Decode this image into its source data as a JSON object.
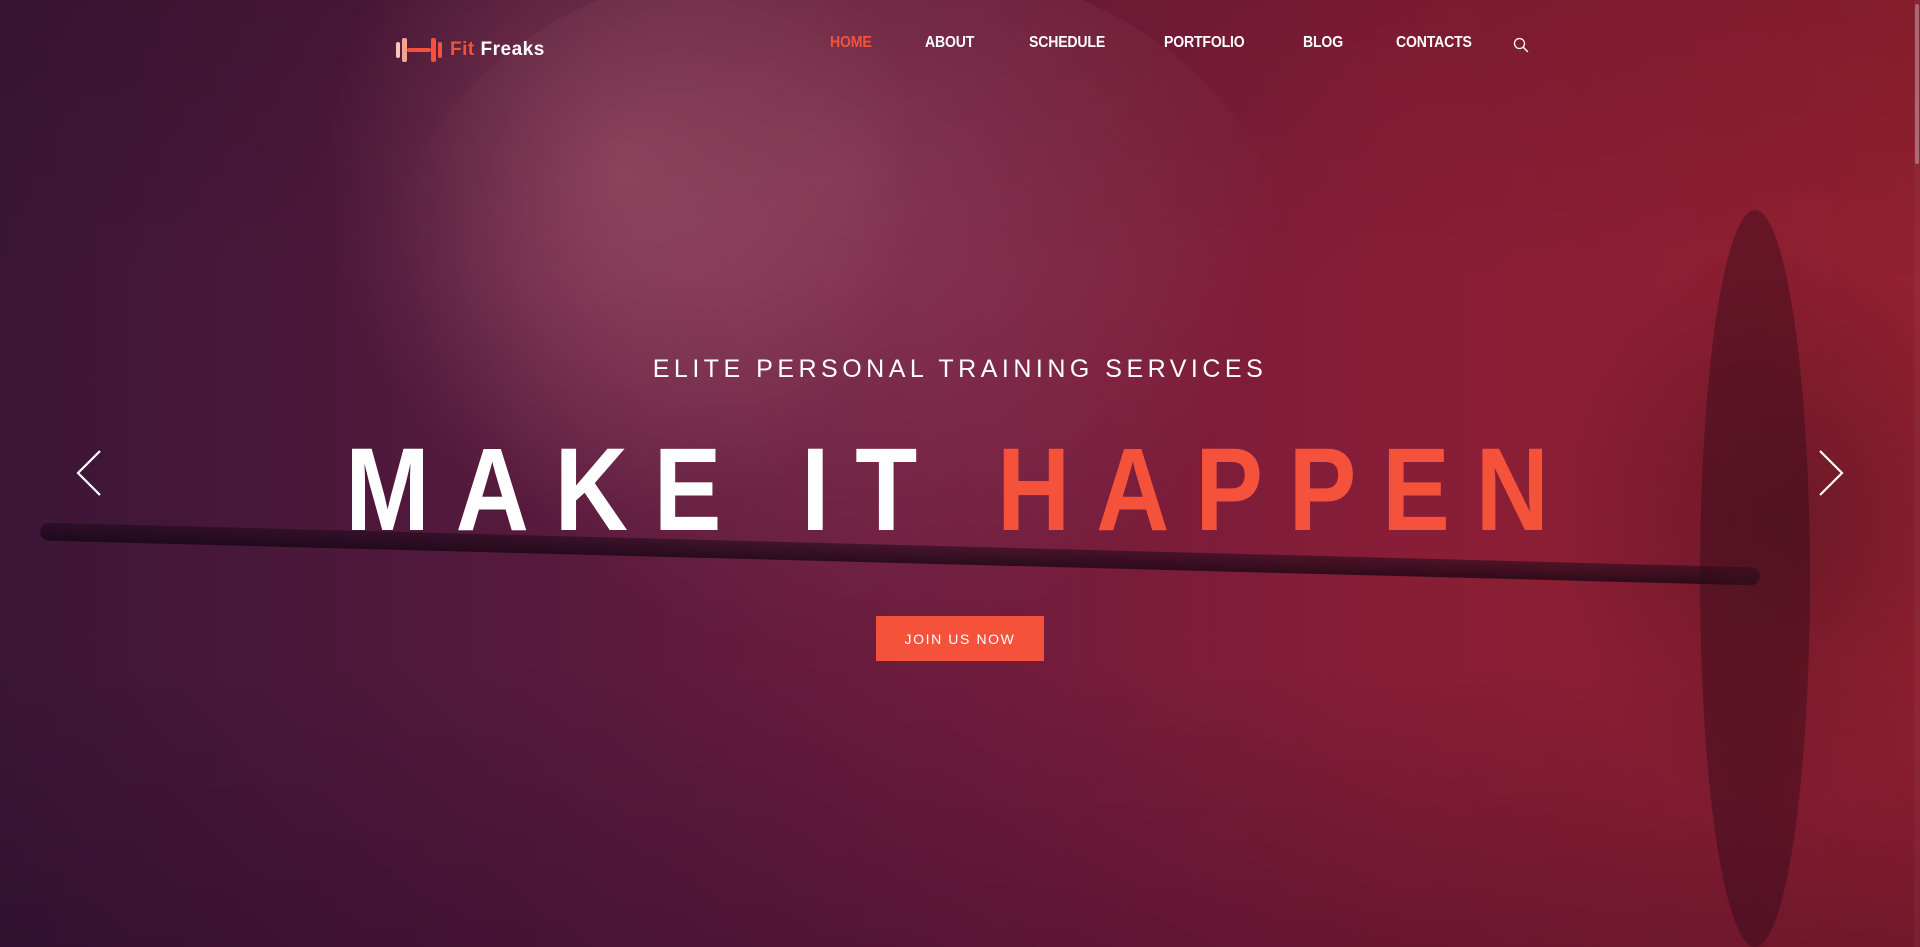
{
  "brand": {
    "name_part1": "Fit ",
    "name_part2": "Freaks",
    "accent_color": "#f4523b"
  },
  "nav": {
    "items": [
      {
        "label": "HOME",
        "active": true
      },
      {
        "label": "ABOUT",
        "active": false
      },
      {
        "label": "SCHEDULE",
        "active": false
      },
      {
        "label": "PORTFOLIO",
        "active": false
      },
      {
        "label": "BLOG",
        "active": false
      },
      {
        "label": "CONTACTS",
        "active": false
      }
    ],
    "search_icon": "search-icon"
  },
  "hero": {
    "subtitle": "ELITE PERSONAL TRAINING SERVICES",
    "headline_white": "MAKE IT ",
    "headline_accent": "HAPPEN",
    "cta_label": "JOIN US NOW",
    "prev_icon": "chevron-left-icon",
    "next_icon": "chevron-right-icon"
  },
  "colors": {
    "background_left": "#3b1637",
    "background_right": "#92202f",
    "accent": "#f4523b",
    "text": "#ffffff"
  }
}
